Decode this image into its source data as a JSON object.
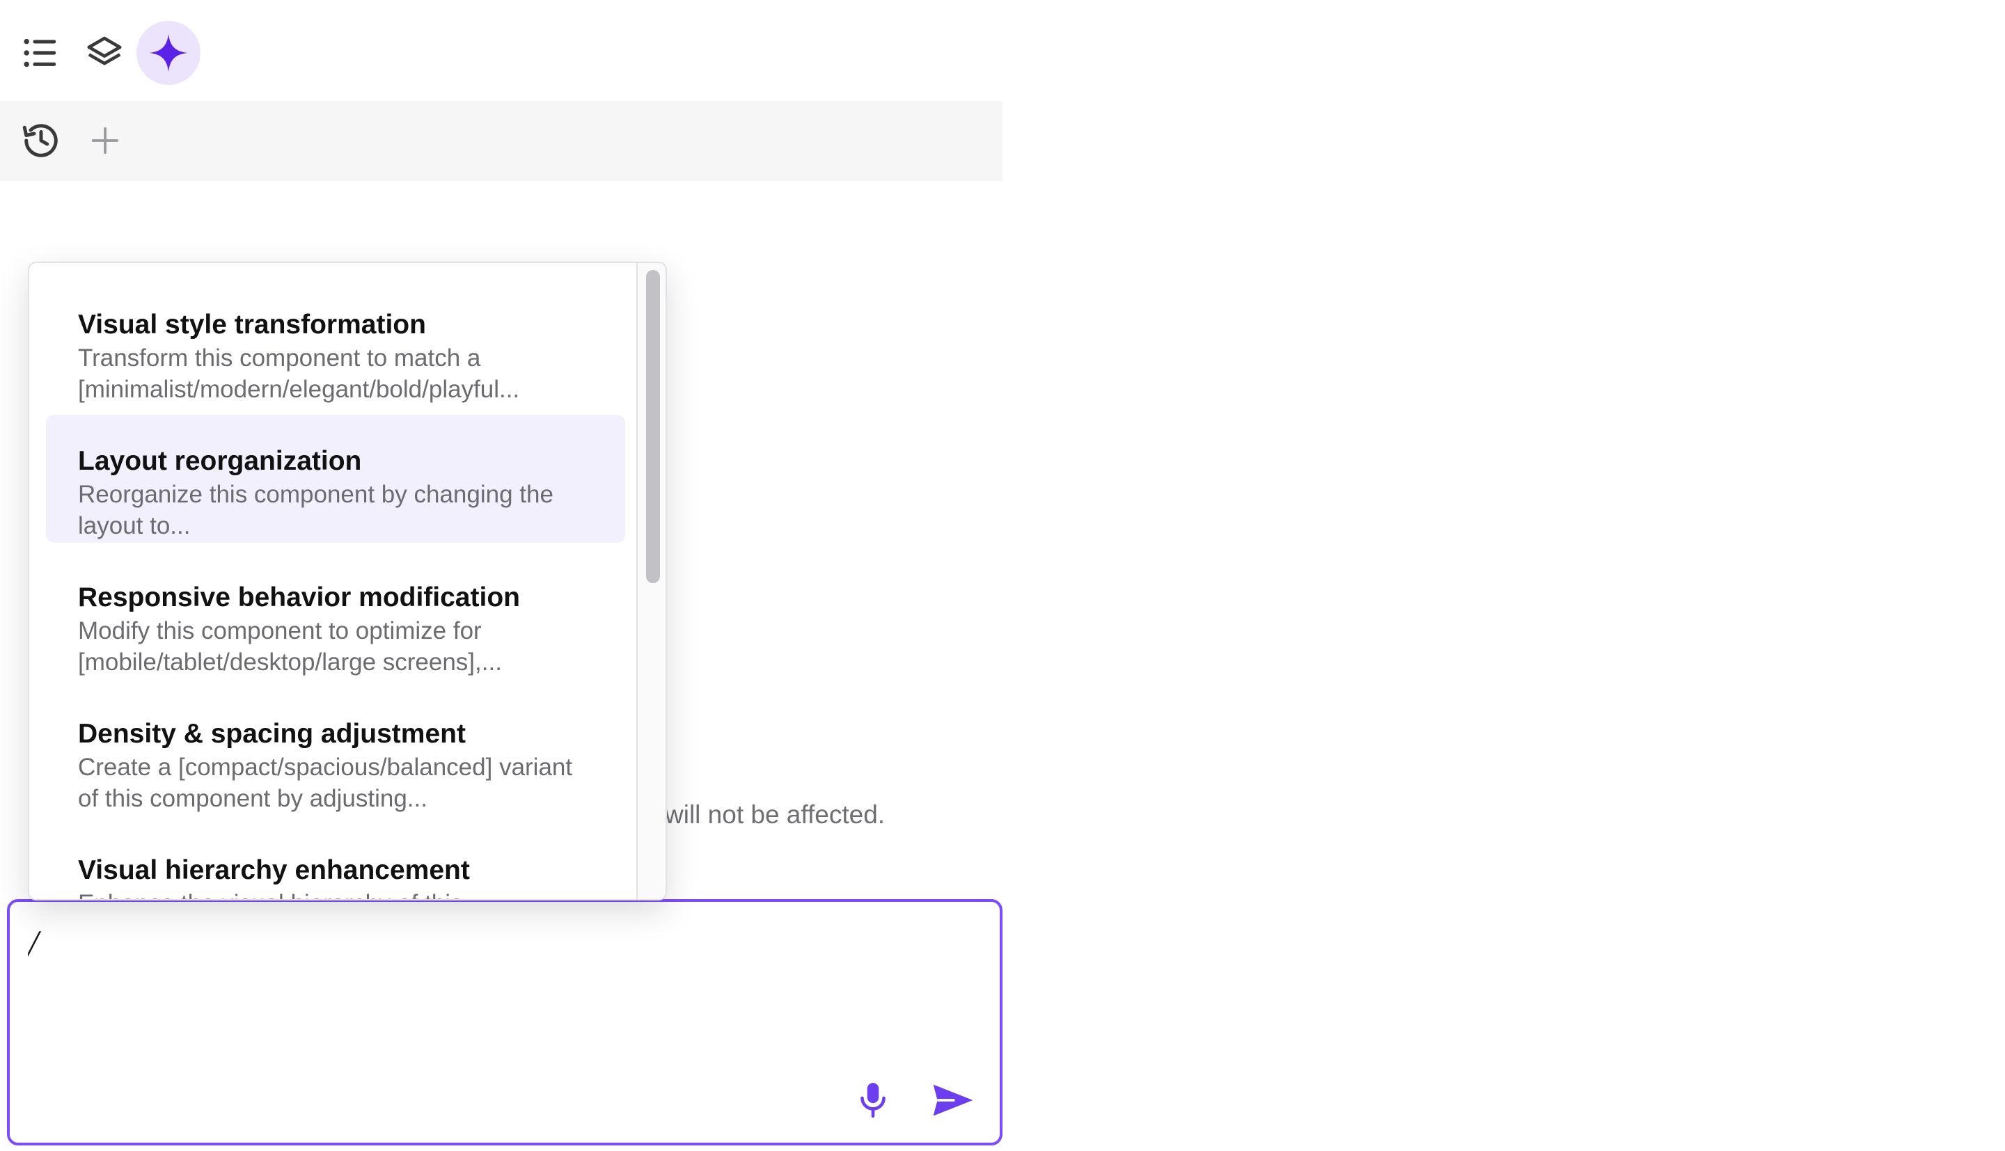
{
  "topbar": {
    "icons": [
      {
        "name": "list-icon",
        "active": false
      },
      {
        "name": "layers-icon",
        "active": false
      },
      {
        "name": "ai-sparkle-icon",
        "active": true
      }
    ]
  },
  "toolbar": {
    "icons": [
      "history-icon",
      "add-icon"
    ]
  },
  "background": {
    "info_text": "will not be affected."
  },
  "prompt": {
    "value": "/",
    "icons": [
      "microphone-icon",
      "send-icon"
    ]
  },
  "suggestions": [
    {
      "title": "Visual style transformation",
      "description": "Transform this component to match a [minimalist/modern/elegant/bold/playful..."
    },
    {
      "title": "Layout reorganization",
      "description": "Reorganize this component by changing the layout to..."
    },
    {
      "title": "Responsive behavior modification",
      "description": "Modify this component to optimize for [mobile/tablet/desktop/large screens],..."
    },
    {
      "title": "Density & spacing adjustment",
      "description": "Create a [compact/spacious/balanced] variant of this component by adjusting..."
    },
    {
      "title": "Visual hierarchy enhancement",
      "description": "Enhance the visual hierarchy of this"
    }
  ],
  "selected_suggestion": 1,
  "colors": {
    "accent": "#7c4dff",
    "accent_soft": "#ebe4fc",
    "highlight": "#f3f0fe",
    "icon": "#3a3a3c",
    "muted_icon": "#9a9aa0"
  }
}
